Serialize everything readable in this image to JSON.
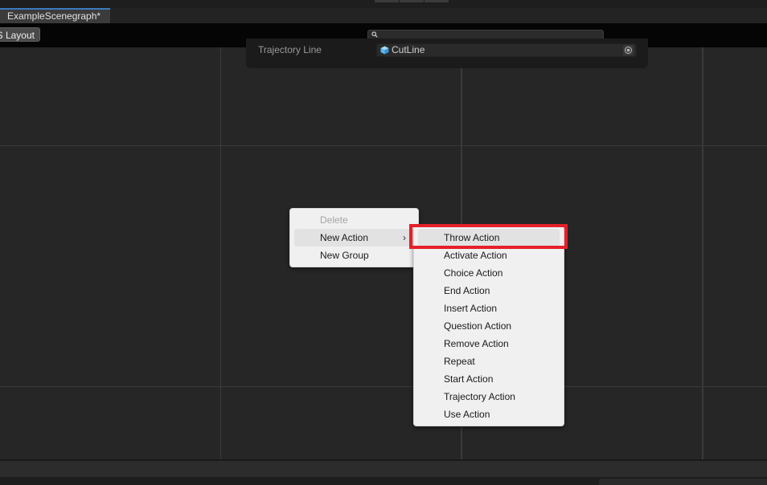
{
  "tabs": [
    {
      "label": "ExampleScenegraph*"
    }
  ],
  "toolbar": {
    "layout_button_label": "S Layout"
  },
  "node": {
    "field_label": "Trajectory Line",
    "field_value": "CutLine"
  },
  "context_menu": {
    "items": [
      {
        "label": "Delete",
        "enabled": false
      },
      {
        "label": "New Action",
        "enabled": true,
        "has_submenu": true,
        "submenu_arrow": "›"
      },
      {
        "label": "New Group",
        "enabled": true
      }
    ]
  },
  "submenu": {
    "items": [
      {
        "label": "Throw Action"
      },
      {
        "label": "Activate Action"
      },
      {
        "label": "Choice Action"
      },
      {
        "label": "End Action"
      },
      {
        "label": "Insert Action"
      },
      {
        "label": "Question Action"
      },
      {
        "label": "Remove Action"
      },
      {
        "label": "Repeat"
      },
      {
        "label": "Start Action"
      },
      {
        "label": "Trajectory Action"
      },
      {
        "label": "Use Action"
      }
    ]
  },
  "colors": {
    "highlight": "#e52029",
    "tab_accent": "#3a79bb",
    "cube_icon": "#5bb7f0"
  }
}
